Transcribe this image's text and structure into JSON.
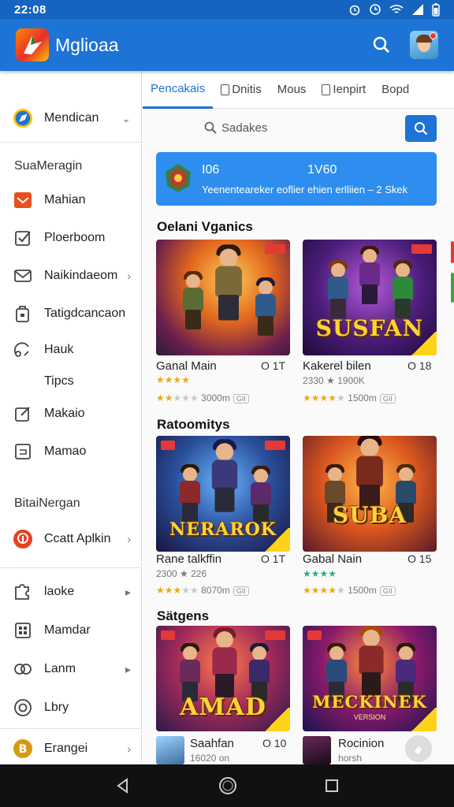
{
  "status_bar": {
    "time": "22:08"
  },
  "app_bar": {
    "title": "Mglioaa"
  },
  "sidebar": {
    "top_item": {
      "label": "Mendican",
      "icon": "compass-icon"
    },
    "section1_header": "SuaMeragin",
    "section1_items": [
      {
        "label": "Mahian",
        "icon": "mail-icon",
        "chevron": false
      },
      {
        "label": "Ploerboom",
        "icon": "checkbox-icon",
        "chevron": false
      },
      {
        "label": "Naikindaeom",
        "icon": "envelope-icon",
        "chevron": true
      },
      {
        "label": "Tatigdcancaon",
        "icon": "bag-icon",
        "chevron": false
      },
      {
        "label": "Hauk",
        "icon": "headset-icon",
        "chevron": false
      },
      {
        "label": "Tipcs",
        "icon": "",
        "chevron": false
      },
      {
        "label": "Makaio",
        "icon": "edit-icon",
        "chevron": false
      },
      {
        "label": "Mamao",
        "icon": "calendar-icon",
        "chevron": false
      }
    ],
    "section2_header": "BitaiNergan",
    "section2_items": [
      {
        "label": "Ccatt Aplkin",
        "icon": "app-store-icon",
        "chevron": true
      }
    ],
    "section3_items": [
      {
        "label": "laoke",
        "icon": "puzzle-icon",
        "chevron": true
      },
      {
        "label": "Mamdar",
        "icon": "grid-icon",
        "chevron": false
      },
      {
        "label": "Lanm",
        "icon": "link-icon",
        "chevron": true
      },
      {
        "label": "Lbry",
        "icon": "target-icon",
        "chevron": false
      },
      {
        "label": "Erangei",
        "icon": "coin-icon",
        "chevron": true
      }
    ]
  },
  "tabs": [
    {
      "label": "Pencakais",
      "active": true
    },
    {
      "label": "Dnitis",
      "active": false
    },
    {
      "label": "Mous",
      "active": false
    },
    {
      "label": "Ienpirt",
      "active": false
    },
    {
      "label": "Bopd",
      "active": false
    }
  ],
  "search": {
    "placeholder": "Sadakes"
  },
  "banner": {
    "left_value": "I06",
    "right_value": "1V60",
    "subtitle": "Yeenenteareker eoflier ehien erlliien – 2 Skek"
  },
  "sections": [
    {
      "title": "Oelani Vganics",
      "cards": [
        {
          "name": "Ganal Main",
          "size": "O 1T",
          "sub": "★★★★",
          "meta_value": "3000m",
          "meta_pill": "GII",
          "stars": 2.5
        },
        {
          "name": "Kakerel bilen",
          "size": "O 18",
          "sub": "2330 ★ 1900K",
          "meta_value": "1500m",
          "meta_pill": "GII",
          "stars": 4,
          "logo_text": "SUSFAN"
        }
      ]
    },
    {
      "title": "Ratoomitys",
      "cards": [
        {
          "name": "Rane talkffin",
          "size": "O 1T",
          "sub": "2300 ★ 226",
          "meta_value": "8070m",
          "meta_pill": "GII",
          "stars": 3,
          "logo_text": "NERAROK"
        },
        {
          "name": "Gabal Nain",
          "size": "O 15",
          "sub": "★★★★",
          "meta_value": "1500m",
          "meta_pill": "GII",
          "stars": 4,
          "logo_text": "SUBA"
        }
      ]
    },
    {
      "title": "Sätgens",
      "cards": [
        {
          "name": "Saahfan",
          "size": "O 10",
          "sub": "16020 on",
          "logo_text": "AMAD"
        },
        {
          "name": "Rocinion",
          "size": "",
          "sub": "horsh",
          "logo_text": "MECKINEK",
          "logo_sub": "VERSION"
        }
      ]
    }
  ],
  "colors": {
    "primary": "#1e74d6",
    "banner": "#2e8ef0",
    "star": "#f2a900",
    "nav_bg": "#111111"
  }
}
